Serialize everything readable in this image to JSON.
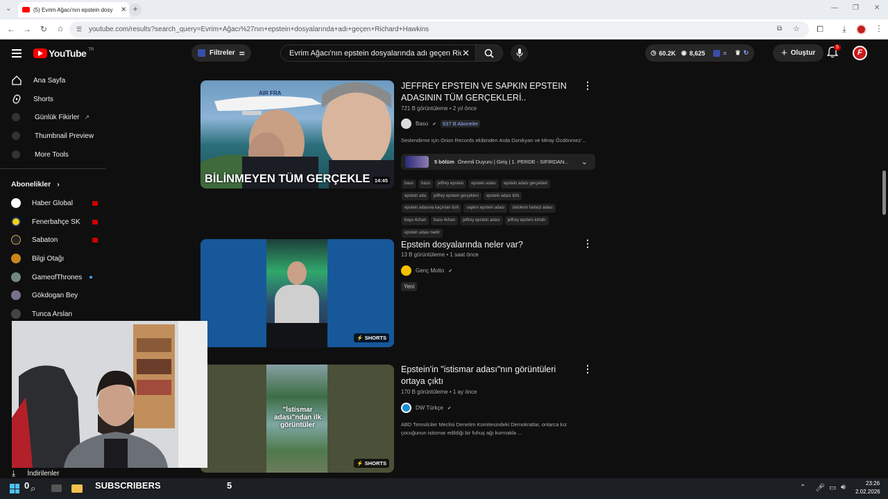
{
  "browser": {
    "tab_title": "(5) Evrim Ağacı'nın epstein dosy",
    "url": "youtube.com/results?search_query=Evrim+Ağacı%27nın+epstein+dosyalarında+adı+geçen+Richard+Hawkins"
  },
  "youtube": {
    "logo_text": "YouTube",
    "region": "TR",
    "filters_label": "Filtreler",
    "search_value": "Evrim Ağacı'nın epstein dosyalarında adı geçen Richard Hawkins",
    "stat_views": "60.2K",
    "stat_eye": "8,625",
    "create_label": "Oluştur",
    "notif_count": "5"
  },
  "sidebar": {
    "main": [
      {
        "label": "Ana Sayfa",
        "icon": "home-icon"
      },
      {
        "label": "Shorts",
        "icon": "shorts-icon"
      },
      {
        "label": "Günlük Fikirler",
        "icon": "extension-icon"
      },
      {
        "label": "Thumbnail Preview",
        "icon": "extension-icon"
      },
      {
        "label": "More Tools",
        "icon": "extension-icon"
      }
    ],
    "subs_heading": "Abonelikler",
    "subs": [
      {
        "label": "Haber Global",
        "color": "#ffffff",
        "live": true
      },
      {
        "label": "Fenerbahçe SK",
        "color": "#f4d10b",
        "live": true
      },
      {
        "label": "Sabaton",
        "color": "#222222",
        "live": true
      },
      {
        "label": "Bilgi Otağı",
        "color": "#c8861d",
        "live": false
      },
      {
        "label": "GameofThrones",
        "color": "#6f8a7d",
        "live": false,
        "dot": true
      },
      {
        "label": "Gökdogan Bey",
        "color": "#7b6f8c",
        "live": false
      },
      {
        "label": "Tunca Arslan",
        "color": "#444444",
        "live": false
      }
    ],
    "downloads_label": "İndirilenler"
  },
  "results": [
    {
      "title_line1": "JEFFREY EPSTEIN VE SAPKIN EPSTEIN",
      "title_line2": "ADASININ TÜM GERÇEKLERİ..",
      "meta": "721 B görüntüleme • 2 yıl önce",
      "channel": "Baso",
      "subs_badge": "637 B Aboneler",
      "desc": "Seslendirme için Orion Records ekibinden Arda Donikyan ve Miray Özdönmez'...",
      "episodes": "5 bölüm",
      "episodes_text": "Önemli Duyuru | Giriş | 1. PERDE - SIFIRDAN...",
      "thumb_text": "BİLİNMEYEN TÜM GERÇEKLE",
      "thumb_plane_text": "AIR FRA",
      "duration": "14:45",
      "tags": [
        "baso",
        "baso",
        "jeffrey epstein",
        "epstein adası",
        "epstein adası gerçekleri",
        "epstein ada",
        "jeffrey epstein gerçekleri",
        "epstein adası türk",
        "epstein adasına kaçırılan türk",
        "sapkın epstein adası",
        "ünlülerin fantezi adası",
        "başo 4chan",
        "baso 4chan",
        "jeffrey epstein adası",
        "jeffrey epstein kimdir",
        "epstein adası nedir"
      ]
    },
    {
      "title_line1": "Epstein dosyalarında neler var?",
      "meta": "13 B görüntüleme • 1 saat önce",
      "channel": "Genç Motto",
      "badge": "Yeni",
      "shorts_label": "SHORTS"
    },
    {
      "title_line1": "Epstein'in \"istismar adası\"nın görüntüleri",
      "title_line2": "ortaya çıktı",
      "meta": "170 B görüntüleme • 1 ay önce",
      "channel": "DW Türkçe",
      "desc_line1": "ABD Temsilciler Meclisi Denetim Komitesindeki Demokratlar, onlarca kız",
      "desc_line2": "çocuğunun istismar edildiği bir fuhuş ağı kurmakla ...",
      "thumb_text": "\"İstismar adası\"ndan ilk görüntüler",
      "shorts_label": "SHORTS"
    }
  ],
  "overlay": {
    "subscribers_label": "SUBSCRIBERS",
    "subscribers_left": "0",
    "subscribers_right": "5"
  },
  "taskbar": {
    "time": "23:26",
    "date": "2.02.2026"
  },
  "colors": {
    "youtube_red": "#ff0000",
    "accent_blue": "#3ea6ff"
  }
}
